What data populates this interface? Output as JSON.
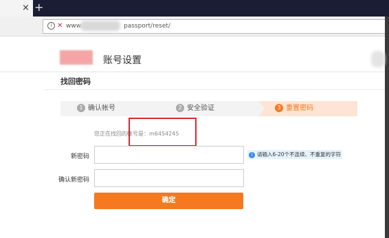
{
  "browser": {
    "tab_close": "×",
    "new_tab": "+",
    "url_prefix": "www.",
    "url_suffix": "passport/reset/"
  },
  "header": {
    "title": "账号设置"
  },
  "section": {
    "title": "找回密码"
  },
  "steps": [
    {
      "num": "1",
      "label": "确认帐号"
    },
    {
      "num": "2",
      "label": "安全验证"
    },
    {
      "num": "3",
      "label": "重置密码"
    }
  ],
  "form": {
    "account_hint": "您正在找回的帐号是：m6454245",
    "new_password_label": "新密码",
    "confirm_password_label": "确认新密码",
    "password_tip": "请输入6-20个不连续、不重复的字符",
    "submit_label": "确定"
  },
  "colors": {
    "accent": "#f47920",
    "highlight_box": "#d9272d"
  },
  "icons": {
    "tab_close": "close-icon",
    "new_tab": "plus-icon",
    "site_info": "info-icon",
    "insecure": "insecure-lock-icon",
    "tip": "info-icon"
  }
}
